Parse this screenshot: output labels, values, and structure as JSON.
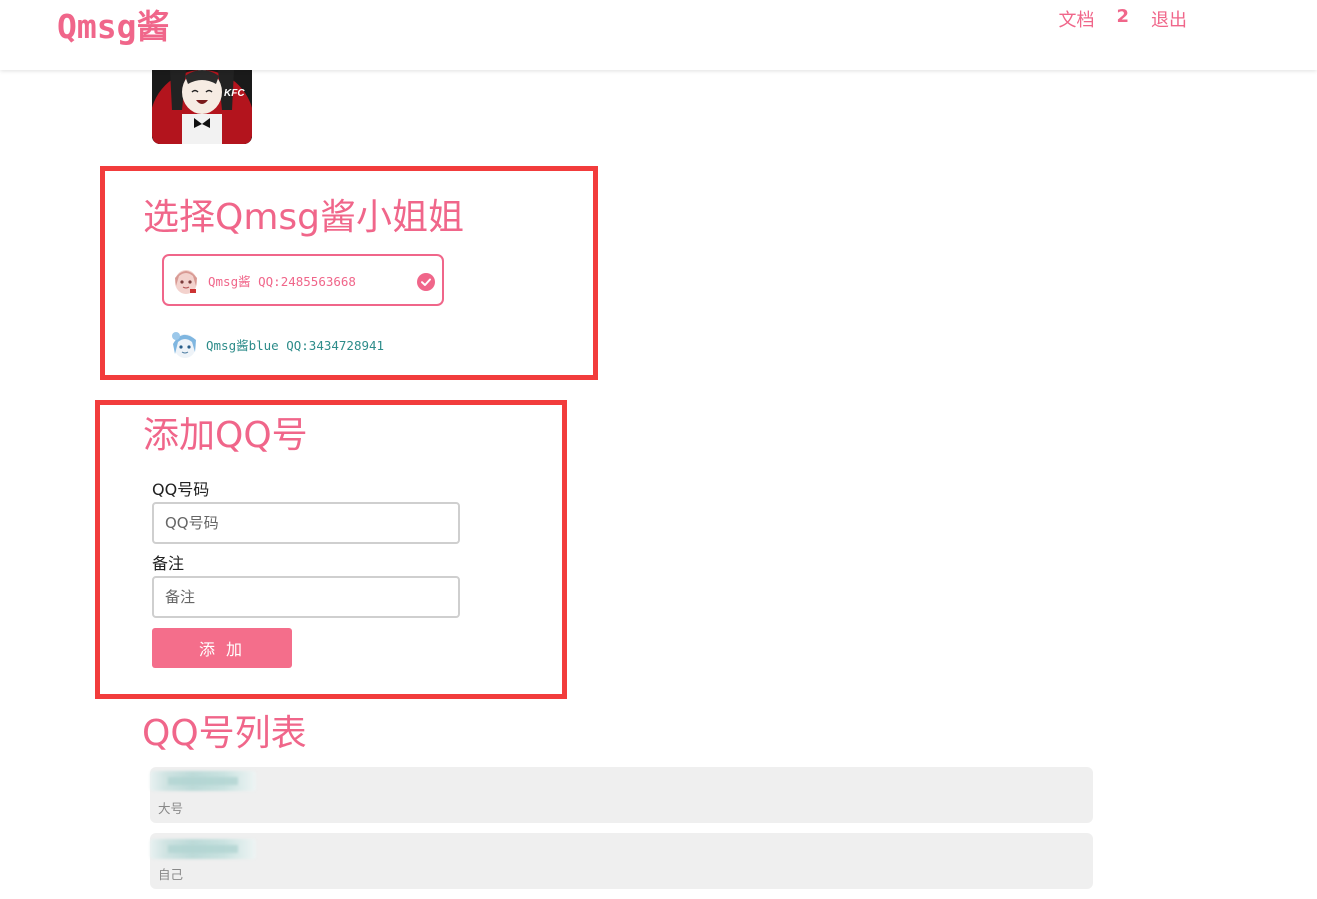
{
  "header": {
    "brand": "Qmsg酱",
    "nav": {
      "docs": "文档",
      "count": "2",
      "logout": "退出"
    }
  },
  "bot_section": {
    "title": "选择Qmsg酱小姐姐",
    "options": [
      {
        "label": "Qmsg酱 QQ:2485563668",
        "selected": true
      },
      {
        "label": "Qmsg酱blue QQ:3434728941",
        "selected": false
      }
    ]
  },
  "add_section": {
    "title": "添加QQ号",
    "qq_label": "QQ号码",
    "qq_placeholder": "QQ号码",
    "note_label": "备注",
    "note_placeholder": "备注",
    "add_button": "添 加"
  },
  "list_section": {
    "title": "QQ号列表",
    "items": [
      {
        "note": "大号"
      },
      {
        "note": "自己"
      }
    ]
  },
  "colors": {
    "accent": "#f0668a",
    "highlight": "#f23c3c",
    "blue_bot": "#2d8c8a"
  }
}
